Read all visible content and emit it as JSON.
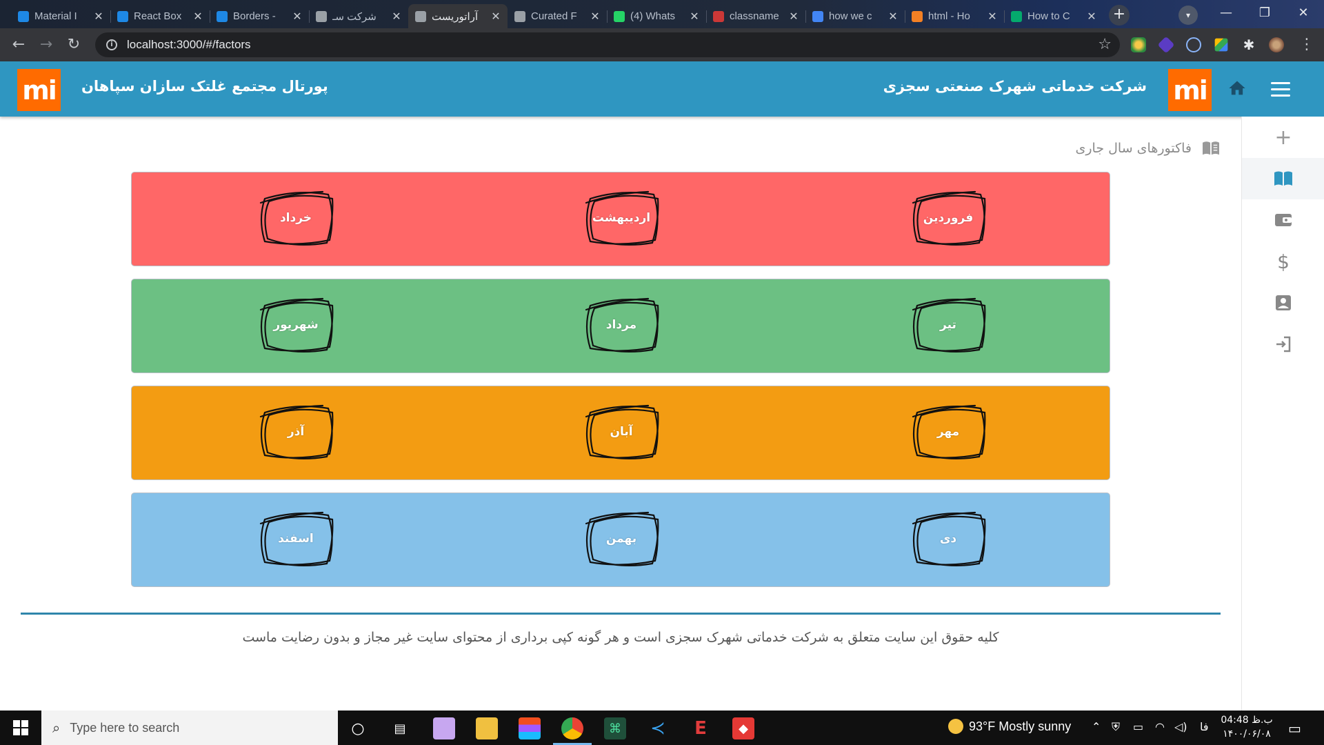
{
  "browser": {
    "tabs": [
      {
        "title": "Material I",
        "icon": "material-ui-icon",
        "color": "#1e88e5"
      },
      {
        "title": "React Box",
        "icon": "material-ui-icon",
        "color": "#1e88e5"
      },
      {
        "title": "Borders -",
        "icon": "material-ui-icon",
        "color": "#1e88e5"
      },
      {
        "title": "شرکت سـ",
        "icon": "globe-icon",
        "color": "#9aa0a6"
      },
      {
        "title": "آراتوریست",
        "icon": "globe-icon",
        "color": "#9aa0a6",
        "active": true
      },
      {
        "title": "Curated F",
        "icon": "globe-icon",
        "color": "#9aa0a6"
      },
      {
        "title": "(4) Whats",
        "icon": "whatsapp-icon",
        "color": "#25d366"
      },
      {
        "title": "classname",
        "icon": "npm-icon",
        "color": "#cb3837"
      },
      {
        "title": "how we c",
        "icon": "google-icon",
        "color": "#4285f4"
      },
      {
        "title": "html - Ho",
        "icon": "stackoverflow-icon",
        "color": "#f48024"
      },
      {
        "title": "How to C",
        "icon": "w3schools-icon",
        "color": "#04aa6d"
      }
    ],
    "url": "localhost:3000/#/factors"
  },
  "header": {
    "right_title": "شرکت خدماتی شهرک صنعتی سجزی",
    "left_title": "پورتال مجتمع غلتک سازان سپاهان",
    "logo_text": "mi",
    "brand_color": "#ff6b00",
    "bar_color": "#2f96c1"
  },
  "sidebar": {
    "items": [
      {
        "icon": "plus-icon"
      },
      {
        "icon": "book-icon",
        "active": true
      },
      {
        "icon": "wallet-icon"
      },
      {
        "icon": "dollar-icon"
      },
      {
        "icon": "contact-card-icon"
      },
      {
        "icon": "logout-icon"
      }
    ]
  },
  "main": {
    "section_title": "فاکتورهای سال جاری",
    "rows": [
      {
        "color": "#ff6767",
        "months": [
          "فروردین",
          "اردیبهشت",
          "خرداد"
        ]
      },
      {
        "color": "#6cc083",
        "months": [
          "تیر",
          "مرداد",
          "شهریور"
        ]
      },
      {
        "color": "#f39c12",
        "months": [
          "مهر",
          "آبان",
          "آذر"
        ]
      },
      {
        "color": "#85c1e9",
        "months": [
          "دی",
          "بهمن",
          "اسفند"
        ]
      }
    ]
  },
  "footer": {
    "text": "کلیه حقوق این سایت متعلق به شرکت خدماتی شهرک سجزی است و هر گونه کپی برداری از محتوای سایت غیر مجاز و بدون رضایت ماست"
  },
  "taskbar": {
    "search_placeholder": "Type here to search",
    "weather": "93°F  Mostly sunny",
    "language": "فا",
    "time": "04:48 ب.ظ",
    "date": "۱۴۰۰/۰۶/۰۸"
  }
}
